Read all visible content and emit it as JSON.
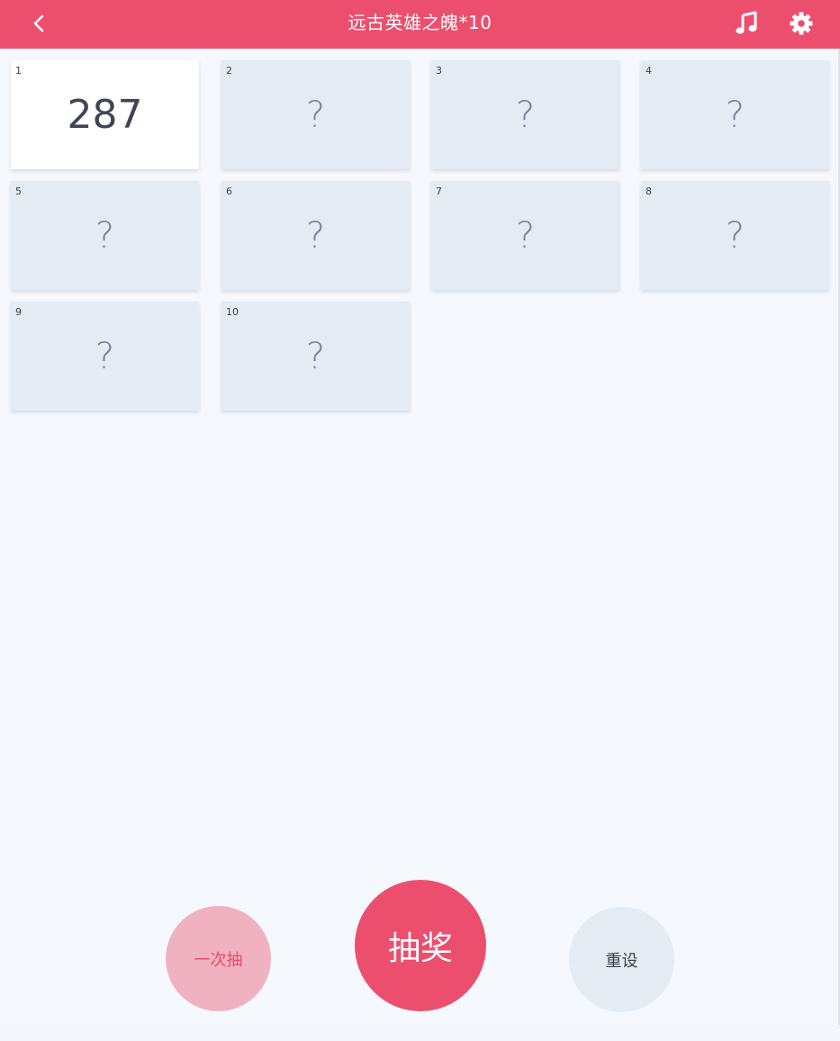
{
  "header": {
    "title": "远古英雄之魄*10",
    "back_icon": "chevron-left-icon",
    "music_icon": "music-note-icon",
    "settings_icon": "gear-icon",
    "background_color": "#ec4f6e"
  },
  "cards": [
    {
      "index": "1",
      "value": "287",
      "revealed": true
    },
    {
      "index": "2",
      "value": "?",
      "revealed": false
    },
    {
      "index": "3",
      "value": "?",
      "revealed": false
    },
    {
      "index": "4",
      "value": "?",
      "revealed": false
    },
    {
      "index": "5",
      "value": "?",
      "revealed": false
    },
    {
      "index": "6",
      "value": "?",
      "revealed": false
    },
    {
      "index": "7",
      "value": "?",
      "revealed": false
    },
    {
      "index": "8",
      "value": "?",
      "revealed": false
    },
    {
      "index": "9",
      "value": "?",
      "revealed": false
    },
    {
      "index": "10",
      "value": "?",
      "revealed": false
    }
  ],
  "actions": {
    "once_label": "一次抽",
    "draw_label": "抽奖",
    "reset_label": "重设"
  },
  "colors": {
    "accent": "#ec4f6e",
    "accent_light": "#f0b2c0",
    "card_hidden": "#e4ebf3",
    "card_revealed": "#ffffff",
    "background": "#f5f9fd"
  }
}
